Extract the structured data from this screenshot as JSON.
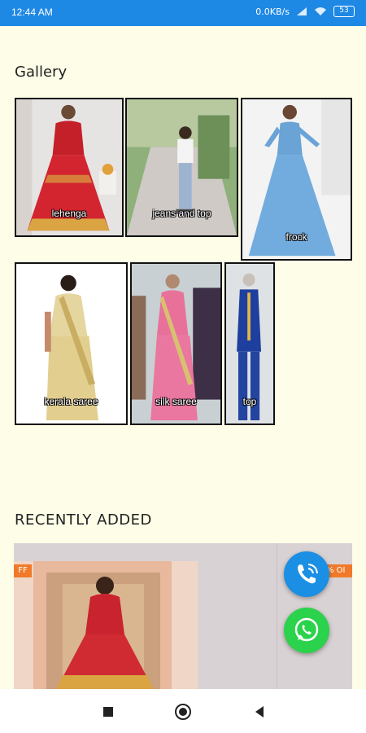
{
  "status_bar": {
    "time": "12:44 AM",
    "network": "0.0KB/s",
    "battery": "53"
  },
  "gallery": {
    "title": "Gallery",
    "items": [
      {
        "label": "lehenga"
      },
      {
        "label": "jeans and top"
      },
      {
        "label": "frock"
      },
      {
        "label": "kerala saree"
      },
      {
        "label": "silk saree"
      },
      {
        "label": "top"
      }
    ]
  },
  "recent": {
    "title": "RECENTLY ADDED",
    "badge_left": "FF",
    "badge_right": "% OI"
  },
  "fabs": {
    "call_icon": "phone-icon",
    "whatsapp_icon": "whatsapp-icon"
  },
  "nav": {
    "recent_icon": "square-icon",
    "home_icon": "circle-icon",
    "back_icon": "triangle-back-icon"
  }
}
